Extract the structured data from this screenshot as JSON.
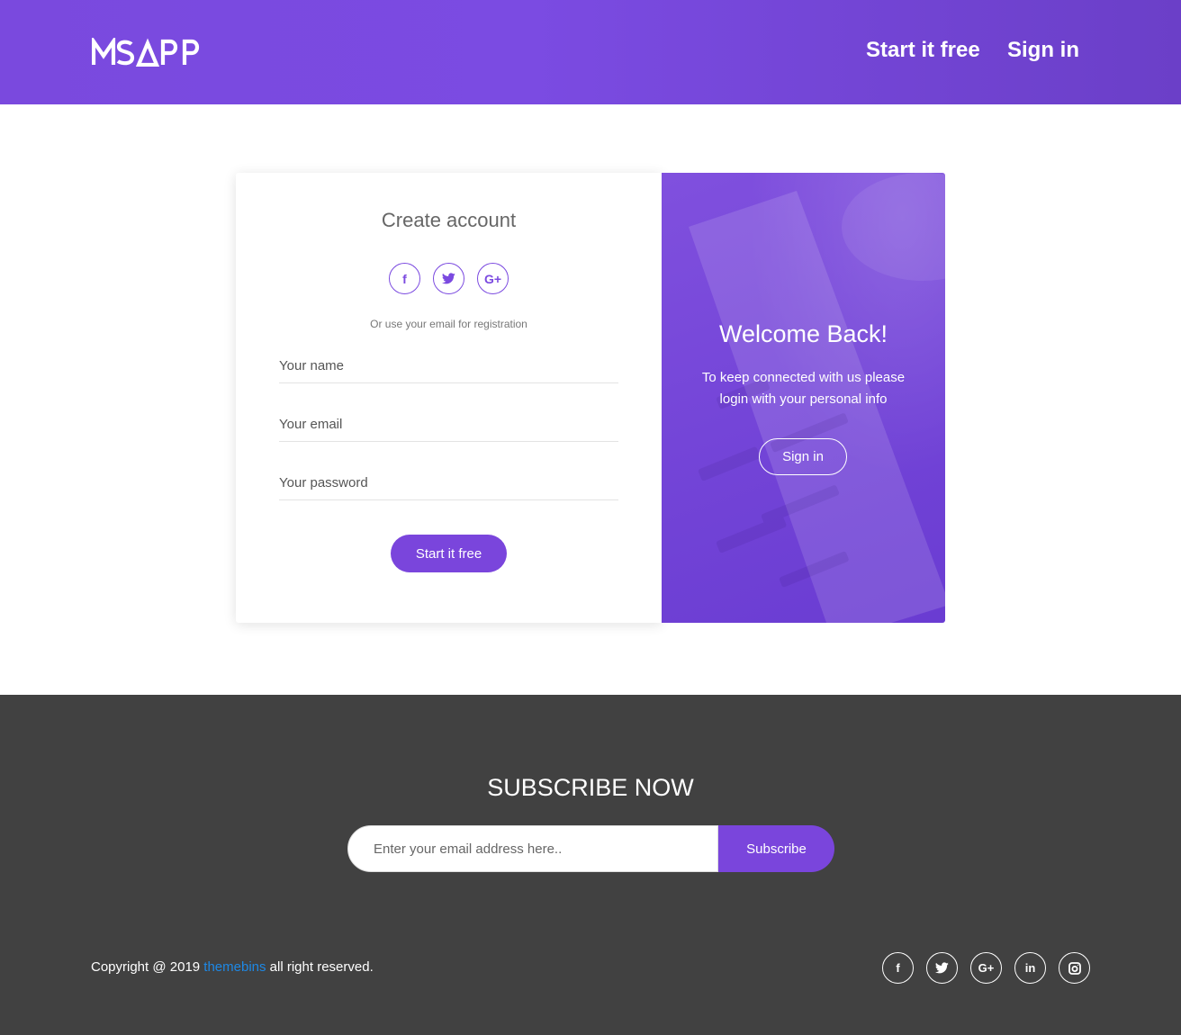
{
  "header": {
    "logo_text": "MSAPP",
    "nav_start_label": "Start it free",
    "nav_signin_label": "Sign in"
  },
  "register": {
    "title": "Create account",
    "social_icons": [
      "facebook-icon",
      "twitter-icon",
      "google-plus-icon"
    ],
    "sub_text": "Or use your email for registration",
    "name_placeholder": "Your name",
    "email_placeholder": "Your email",
    "password_placeholder": "Your password",
    "submit_label": "Start it free"
  },
  "welcome": {
    "title": "Welcome Back!",
    "text": "To keep connected with us please login with your personal info",
    "signin_label": "Sign in"
  },
  "subscribe": {
    "heading": "SUBSCRIBE NOW",
    "email_placeholder": "Enter your email address here..",
    "button_label": "Subscribe"
  },
  "footer": {
    "copyright_prefix": "Copyright @ 2019 ",
    "brand_link": "themebins",
    "copyright_suffix": " all right reserved.",
    "social_icons": [
      "facebook-icon",
      "twitter-icon",
      "google-plus-icon",
      "linkedin-icon",
      "instagram-icon"
    ]
  },
  "colors": {
    "brand_purple": "#7a45dc",
    "footer_bg": "#414141",
    "link_blue": "#1e88e5"
  }
}
